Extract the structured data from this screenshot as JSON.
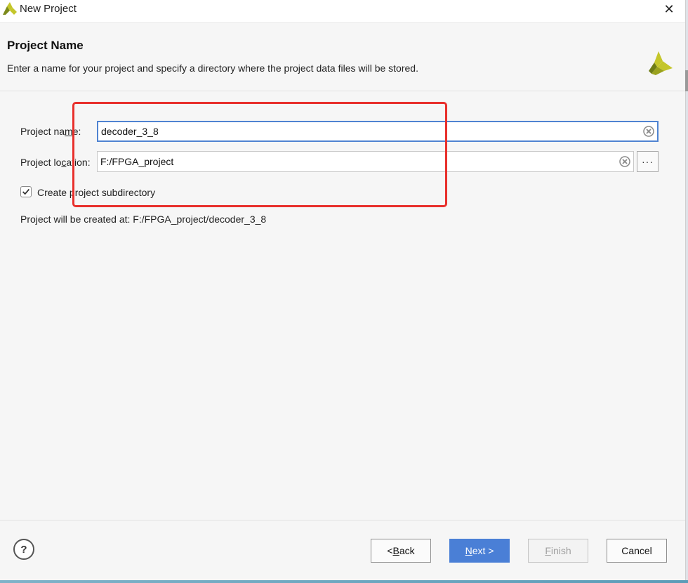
{
  "window": {
    "title": "New Project"
  },
  "header": {
    "title": "Project Name",
    "description": "Enter a name for your project and specify a directory where the project data files will be stored."
  },
  "form": {
    "project_name": {
      "label_pre": "Project na",
      "label_accel": "m",
      "label_post": "e:",
      "value": "decoder_3_8"
    },
    "project_location": {
      "label_pre": "Project lo",
      "label_accel": "c",
      "label_post": "ation:",
      "value": "F:/FPGA_project",
      "browse_label": "···"
    },
    "subdirectory": {
      "label": "Create project subdirectory",
      "checked": true
    },
    "created_at": "Project will be created at: F:/FPGA_project/decoder_3_8"
  },
  "footer": {
    "help_label": "?",
    "back_pre": "< ",
    "back_accel": "B",
    "back_post": "ack",
    "next_accel": "N",
    "next_post": "ext >",
    "finish_accel": "F",
    "finish_post": "inish",
    "cancel_label": "Cancel"
  },
  "colors": {
    "accent": "#4a7fd6",
    "highlight_box": "#e8302c",
    "logo": "#c4c62a"
  },
  "icons": {
    "app": "vivado-logo-icon",
    "close": "close-icon",
    "clear": "clear-circle-icon",
    "check": "checkmark-icon"
  }
}
